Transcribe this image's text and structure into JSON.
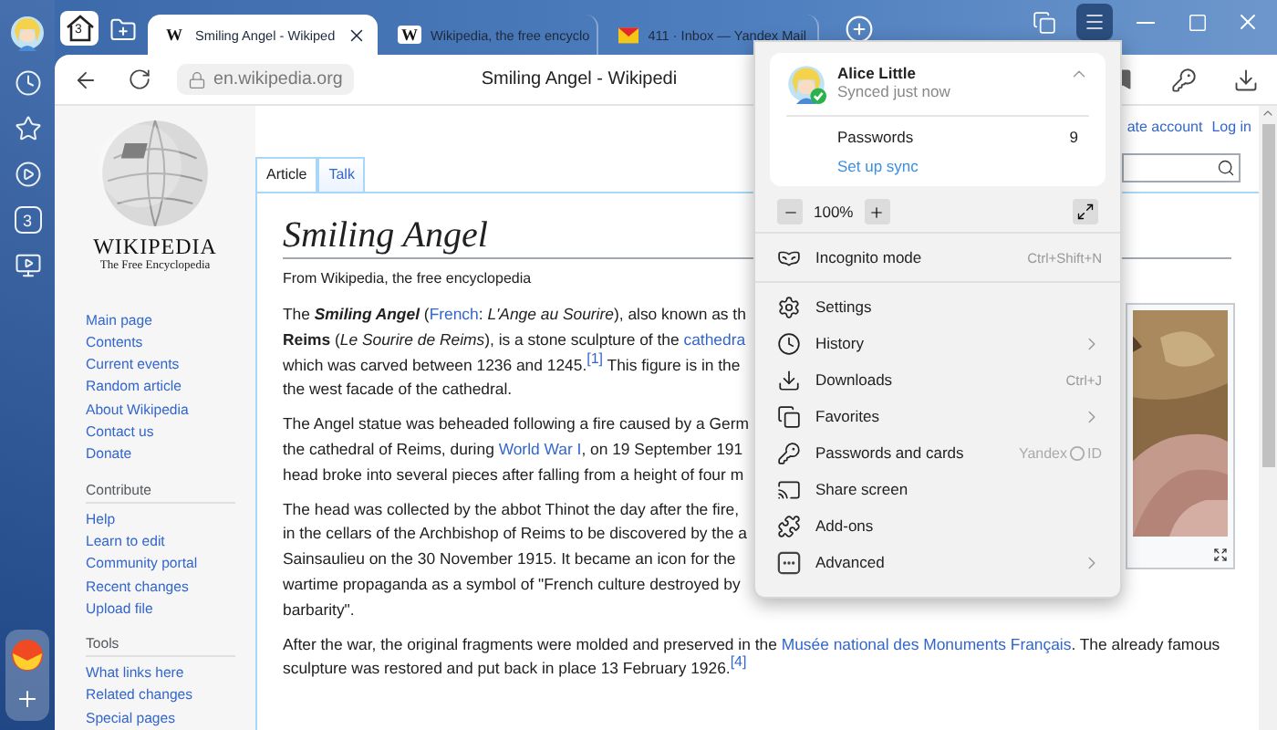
{
  "rail": {
    "counter": "3"
  },
  "tab_strip": {
    "home_count": "3",
    "tabs": [
      {
        "kind": "wiki",
        "favicon": "W",
        "title": "Smiling Angel - Wikiped",
        "selected": true
      },
      {
        "kind": "wiki",
        "favicon": "W",
        "title": "Wikipedia, the free encyclo",
        "selected": false
      },
      {
        "kind": "mail",
        "title": "411 · Inbox — Yandex Mail",
        "selected": false
      }
    ]
  },
  "menu_open": true,
  "toolbar": {
    "address": "en.wikipedia.org",
    "page_title": "Smiling Angel - Wikipedi"
  },
  "wiki": {
    "logo_title": "WIKIPEDIA",
    "logo_tagline": "The Free Encyclopedia",
    "nav": [
      {
        "links": [
          "Main page",
          "Contents",
          "Current events",
          "Random article",
          "About Wikipedia",
          "Contact us",
          "Donate"
        ]
      },
      {
        "heading": "Contribute",
        "links": [
          "Help",
          "Learn to edit",
          "Community portal",
          "Recent changes",
          "Upload file"
        ]
      },
      {
        "heading": "Tools",
        "links": [
          "What links here",
          "Related changes",
          "Special pages"
        ]
      }
    ],
    "user_links": [
      "ate account",
      "Log in"
    ],
    "page_tabs": [
      {
        "label": "Article",
        "selected": true
      },
      {
        "label": "Talk",
        "selected": false
      }
    ]
  },
  "article": {
    "title": "Smiling Angel",
    "subtitle": "From Wikipedia, the free encyclopedia",
    "paragraphs": [
      {
        "lines": [
          [
            {
              "text": "The ",
              "kind": "plain"
            },
            {
              "text": "Smiling Angel",
              "kind": "bold-italic"
            },
            {
              "text": " (",
              "kind": "plain"
            },
            {
              "text": "French",
              "kind": "link"
            },
            {
              "text": ": ",
              "kind": "plain"
            },
            {
              "text": "L'Ange au Sourire",
              "kind": "italic"
            },
            {
              "text": "), also known as th",
              "kind": "plain"
            }
          ],
          [
            {
              "text": "Reims",
              "kind": "bold"
            },
            {
              "text": " (",
              "kind": "plain"
            },
            {
              "text": "Le Sourire de Reims",
              "kind": "italic"
            },
            {
              "text": "), is a stone sculpture of the ",
              "kind": "plain"
            },
            {
              "text": "cathedra",
              "kind": "link"
            }
          ],
          [
            {
              "text": "which was carved between 1236 and 1245.",
              "kind": "plain"
            },
            {
              "text": "[1]",
              "kind": "footnote"
            },
            {
              "text": " This figure is in the",
              "kind": "plain"
            }
          ],
          [
            {
              "text": "the west facade of the cathedral.",
              "kind": "plain"
            }
          ]
        ]
      },
      {
        "lines": [
          [
            {
              "text": "The Angel statue was beheaded following a fire caused by a Germ",
              "kind": "plain"
            }
          ],
          [
            {
              "text": "the cathedral of Reims, during ",
              "kind": "plain"
            },
            {
              "text": "World War I",
              "kind": "link"
            },
            {
              "text": ", on 19 September 191",
              "kind": "plain"
            }
          ],
          [
            {
              "text": "head broke into several pieces after falling from a height of four m",
              "kind": "plain"
            }
          ]
        ]
      },
      {
        "lines": [
          [
            {
              "text": "The head was collected by the abbot Thinot the day after the fire,",
              "kind": "plain"
            }
          ],
          [
            {
              "text": "in the cellars of the Archbishop of Reims to be discovered by the a",
              "kind": "plain"
            }
          ],
          [
            {
              "text": "Sainsaulieu on the 30 November 1915. It became an icon for the",
              "kind": "plain"
            }
          ],
          [
            {
              "text": "wartime propaganda as a symbol of \"French culture destroyed by",
              "kind": "plain"
            }
          ],
          [
            {
              "text": "barbarity\".",
              "kind": "plain"
            }
          ]
        ]
      },
      {
        "lines": [
          [
            {
              "text": "After the war, the original fragments were molded and preserved in the ",
              "kind": "plain"
            },
            {
              "text": "Musée national des Monuments Français",
              "kind": "link"
            },
            {
              "text": ". The already famous",
              "kind": "plain"
            }
          ],
          [
            {
              "text": "sculpture was restored and put back in place 13 February 1926.",
              "kind": "plain"
            },
            {
              "text": "[4]",
              "kind": "footnote"
            }
          ]
        ]
      }
    ]
  },
  "menu": {
    "profile": {
      "name": "Alice Little",
      "status": "Synced just now",
      "expanded": true,
      "passwords_label": "Passwords",
      "passwords_count": "9",
      "sync_link": "Set up sync"
    },
    "zoom_text": "100%",
    "incognito": {
      "label": "Incognito mode",
      "shortcut": "Ctrl+Shift+N"
    },
    "items": [
      {
        "label": "Settings",
        "submenu": false
      },
      {
        "label": "History",
        "submenu": true
      },
      {
        "label": "Downloads",
        "submenu": false,
        "shortcut": "Ctrl+J"
      },
      {
        "label": "Favorites",
        "submenu": true
      },
      {
        "label": "Passwords and cards",
        "submenu": false,
        "badge": {
          "before": "Yandex",
          "after": "ID"
        }
      },
      {
        "label": "Share screen",
        "submenu": false
      },
      {
        "label": "Add-ons",
        "submenu": false
      },
      {
        "label": "Advanced",
        "submenu": true
      }
    ]
  }
}
